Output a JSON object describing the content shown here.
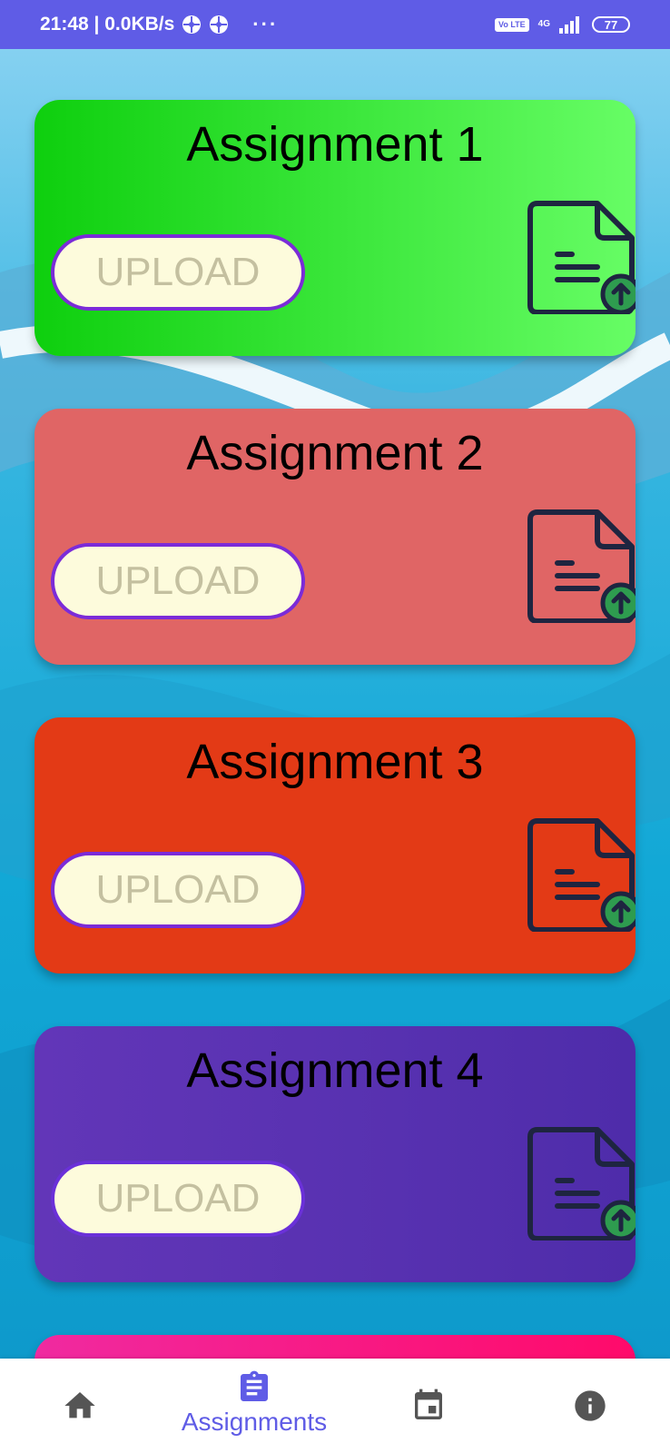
{
  "status_bar": {
    "time_speed": "21:48 | 0.0KB/s",
    "more": "···",
    "volte": "Vo LTE",
    "network": "4G",
    "battery": "77"
  },
  "cards": [
    {
      "title": "Assignment 1",
      "upload_label": "UPLOAD",
      "color": "#2ad62a"
    },
    {
      "title": "Assignment 2",
      "upload_label": "UPLOAD",
      "color": "#e06565"
    },
    {
      "title": "Assignment 3",
      "upload_label": "UPLOAD",
      "color": "#e33a16"
    },
    {
      "title": "Assignment 4",
      "upload_label": "UPLOAD",
      "color": "#5a32b0"
    }
  ],
  "bottom_nav": {
    "items": [
      {
        "icon": "home-icon",
        "label": ""
      },
      {
        "icon": "assignment-icon",
        "label": "Assignments",
        "active": true
      },
      {
        "icon": "calendar-icon",
        "label": ""
      },
      {
        "icon": "info-icon",
        "label": ""
      }
    ],
    "active_color": "#5f5ce6",
    "inactive_color": "#555555"
  }
}
